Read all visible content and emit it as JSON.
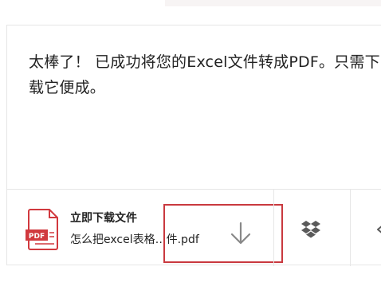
{
  "message": {
    "text": "太棒了！ 已成功将您的Excel文件转成PDF。只需下载它便成。"
  },
  "download": {
    "title": "立即下载文件",
    "filename": "怎么把excel表格…件.pdf",
    "file_icon": "pdf-file-icon",
    "file_icon_label": "PDF",
    "download_icon": "download-arrow-icon",
    "dropbox_icon": "dropbox-icon",
    "partial_icon": "share-icon"
  },
  "colors": {
    "accent": "#c9393f",
    "text": "#222222",
    "border": "#e6e6e6"
  }
}
